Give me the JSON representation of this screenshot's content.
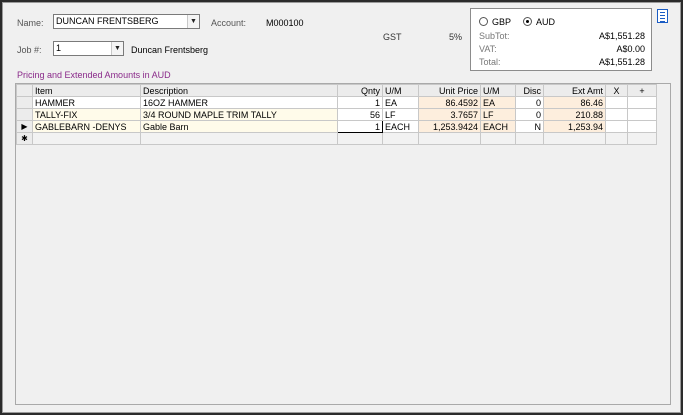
{
  "header": {
    "name_label": "Name:",
    "name_value": "DUNCAN FRENTSBERG",
    "account_label": "Account:",
    "account_value": "M000100",
    "job_label": "Job #:",
    "job_value": "1",
    "job_name": "Duncan Frentsberg",
    "gst_label": "GST",
    "gst_value": "5%"
  },
  "currency": {
    "options": [
      "GBP",
      "AUD"
    ],
    "selected": "AUD",
    "subtot_label": "SubTot:",
    "subtot_value": "A$1,551.28",
    "vat_label": "VAT:",
    "vat_value": "A$0.00",
    "total_label": "Total:",
    "total_value": "A$1,551.28"
  },
  "section_title": "Pricing and Extended Amounts in AUD",
  "grid": {
    "columns": [
      "Item",
      "Description",
      "Qnty",
      "U/M",
      "Unit Price",
      "U/M",
      "Disc",
      "Ext Amt",
      "X",
      "+"
    ],
    "rows": [
      {
        "indicator": "",
        "item": "HAMMER",
        "description": "16OZ HAMMER",
        "qnty": "1",
        "um": "EA",
        "unit_price": "86.4592",
        "um2": "EA",
        "disc": "0",
        "ext_amt": "86.46",
        "x": "",
        "plus": ""
      },
      {
        "indicator": "",
        "item": "TALLY-FIX",
        "description": "3/4 ROUND MAPLE TRIM TALLY",
        "qnty": "56",
        "um": "LF",
        "unit_price": "3.7657",
        "um2": "LF",
        "disc": "0",
        "ext_amt": "210.88",
        "x": "",
        "plus": ""
      },
      {
        "indicator": "▶",
        "item": "GABLEBARN -DENYS",
        "description": "Gable Barn",
        "qnty": "1",
        "um": "EACH",
        "unit_price": "1,253.9424",
        "um2": "EACH",
        "disc": "N",
        "ext_amt": "1,253.94",
        "x": "",
        "plus": ""
      }
    ],
    "new_row_indicator": "✱"
  },
  "icons": {
    "menu_top": "menu-list-icon",
    "menu_grid": "menu-list-icon"
  }
}
